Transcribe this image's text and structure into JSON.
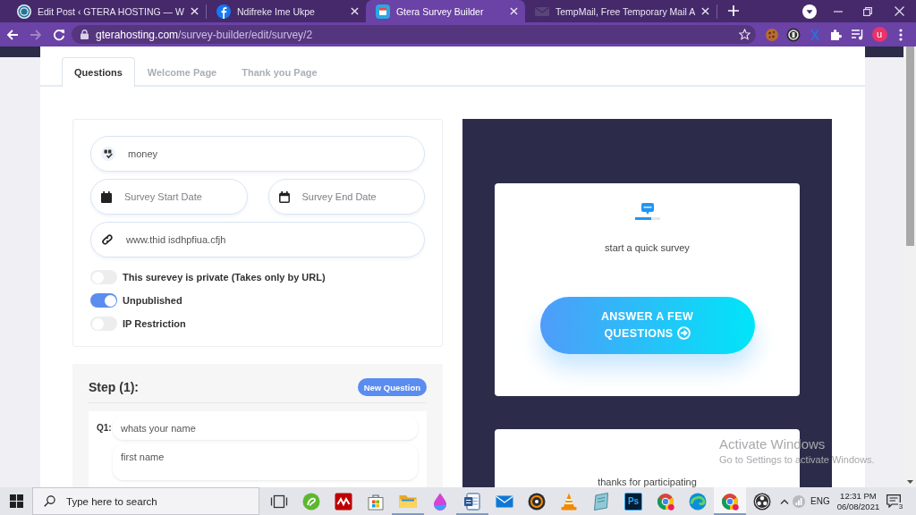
{
  "browser": {
    "tabs": [
      {
        "kind": "wordpress",
        "title": "Edit Post ‹ GTERA HOSTING — W",
        "selected": false
      },
      {
        "kind": "facebook",
        "title": "Ndifreke Ime Ukpe",
        "selected": false
      },
      {
        "kind": "survey",
        "title": "Gtera Survey Builder",
        "selected": true
      },
      {
        "kind": "mail",
        "title": "TempMail, Free Temporary Mail A",
        "selected": false
      }
    ],
    "address": {
      "host": "gterahosting.com",
      "path": "/survey-builder/edit/survey/2"
    },
    "profile_initial": "u"
  },
  "editor_tabs": [
    {
      "label": "Questions",
      "selected": true
    },
    {
      "label": "Welcome Page",
      "selected": false
    },
    {
      "label": "Thank you Page",
      "selected": false
    }
  ],
  "settings": {
    "fields": [
      {
        "kind": "title",
        "value": "money"
      },
      {
        "kind": "start-date",
        "placeholder": "Survey Start Date"
      },
      {
        "kind": "end-date",
        "placeholder": "Survey End Date"
      },
      {
        "kind": "url",
        "value": "www.thid isdhpfiua.cfjh"
      }
    ],
    "toggles": [
      {
        "label": "This surevey is private (Takes only by URL)",
        "on": false
      },
      {
        "label": "Unpublished",
        "on": true
      },
      {
        "label": "IP Restriction",
        "on": false
      }
    ]
  },
  "step": {
    "title": "Step (1):",
    "new_question_button": "New Question",
    "questions": [
      {
        "number": "Q1:",
        "question": "whats your name",
        "answer": "first name"
      }
    ]
  },
  "preview": {
    "welcome": {
      "text": "start a quick survey",
      "button": "ANSWER A FEW QUESTIONS"
    },
    "thanks": {
      "text": "thanks for participating"
    }
  },
  "activation_notice": {
    "title": "Activate Windows",
    "text": "Go to Settings to activate Windows."
  },
  "taskbar": {
    "search_placeholder": "Type here to search",
    "apps": [
      {
        "kind": "task-view",
        "running": false,
        "active": false
      },
      {
        "kind": "swirl",
        "running": false,
        "active": false
      },
      {
        "kind": "zigzag",
        "running": false,
        "active": false
      },
      {
        "kind": "store",
        "running": false,
        "active": false
      },
      {
        "kind": "folder",
        "running": true,
        "active": false
      },
      {
        "kind": "drop",
        "running": false,
        "active": false
      },
      {
        "kind": "document",
        "running": true,
        "active": false
      },
      {
        "kind": "envelope",
        "running": false,
        "active": false
      },
      {
        "kind": "disc",
        "running": false,
        "active": false
      },
      {
        "kind": "cone",
        "running": false,
        "active": false
      },
      {
        "kind": "paper",
        "running": false,
        "active": false
      },
      {
        "kind": "photoshop",
        "label": "Ps",
        "running": false,
        "active": false
      },
      {
        "kind": "browser",
        "running": false,
        "active": false
      },
      {
        "kind": "wave",
        "running": false,
        "active": false
      },
      {
        "kind": "browser",
        "running": true,
        "active": true
      },
      {
        "kind": "obs",
        "running": false,
        "active": false
      }
    ],
    "language": "ENG",
    "time": "12:31 PM",
    "date": "06/08/2021",
    "notification_count": "3"
  }
}
